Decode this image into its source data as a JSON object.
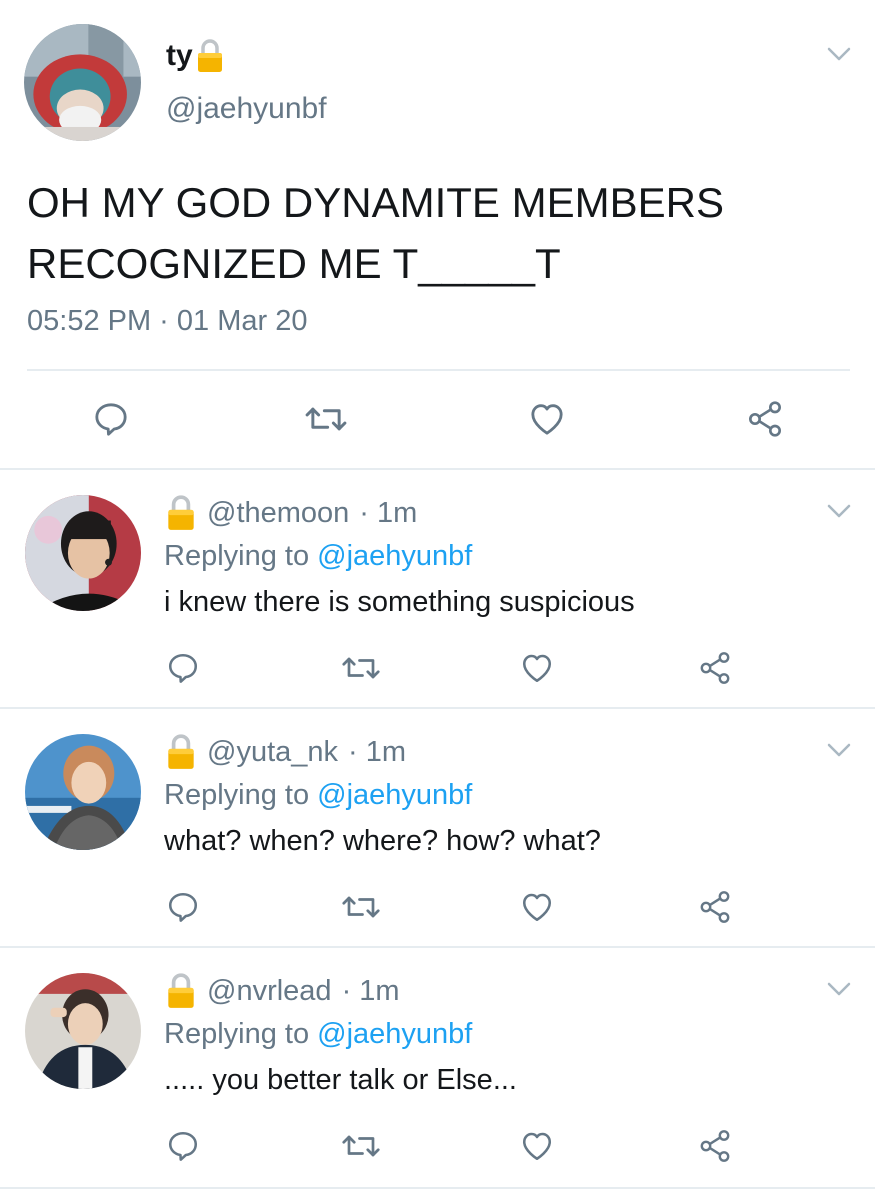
{
  "main_tweet": {
    "display_name": "ty",
    "handle": "@jaehyunbf",
    "text": "OH MY GOD DYNAMITE MEMBERS RECOGNIZED ME T_____T",
    "timestamp": "05:52 PM · 01 Mar 20",
    "icons": [
      "lock-icon",
      "chevron-down-icon",
      "reply-icon",
      "retweet-icon",
      "like-icon",
      "share-icon"
    ]
  },
  "replies": [
    {
      "handle": "@themoon",
      "time": "· 1m",
      "replying_prefix": "Replying to",
      "replying_handle": "@jaehyunbf",
      "text": "i knew there is something suspicious"
    },
    {
      "handle": "@yuta_nk",
      "time": "· 1m",
      "replying_prefix": "Replying to",
      "replying_handle": "@jaehyunbf",
      "text": "what? when? where? how? what?"
    },
    {
      "handle": "@nvrlead",
      "time": "· 1m",
      "replying_prefix": "Replying to",
      "replying_handle": "@jaehyunbf",
      "text": "..... you better talk or Else..."
    }
  ],
  "colors": {
    "text_primary": "#14171a",
    "text_secondary": "#657786",
    "link": "#1da1f2",
    "divider": "#e6ecf0",
    "icon": "#657786",
    "lock_gold": "#f5b400"
  }
}
